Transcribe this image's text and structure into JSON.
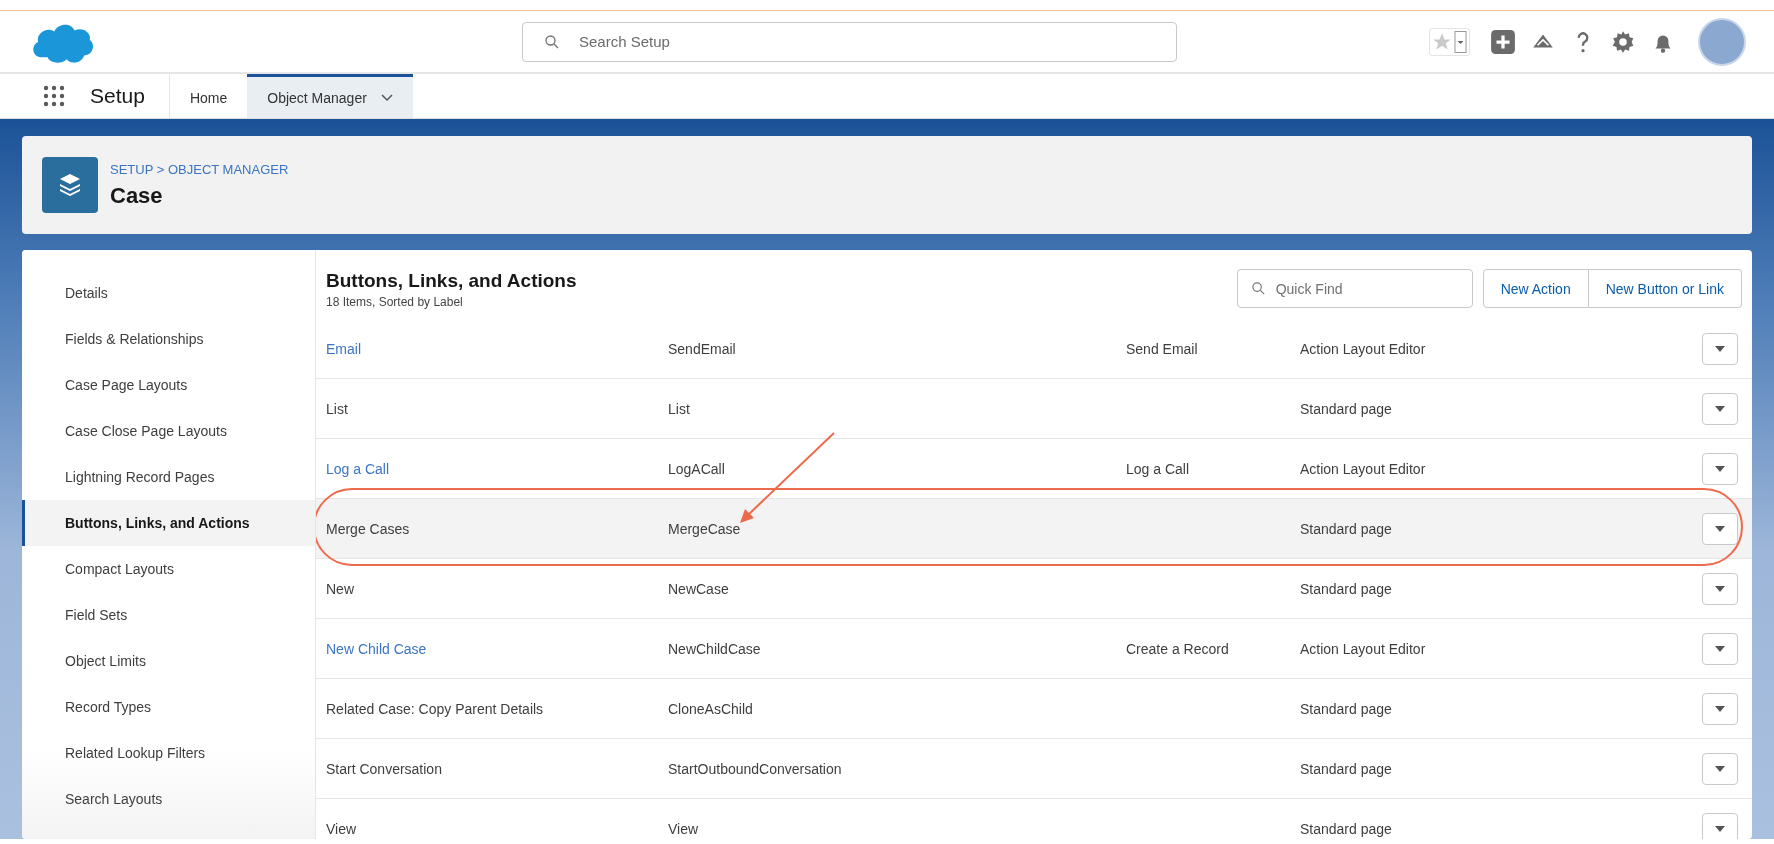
{
  "header": {
    "search": {
      "placeholder": "Search Setup"
    }
  },
  "nav": {
    "app_name": "Setup",
    "tabs": [
      {
        "label": "Home",
        "selected": false,
        "dropdown": false
      },
      {
        "label": "Object Manager",
        "selected": true,
        "dropdown": true
      }
    ]
  },
  "page_header": {
    "breadcrumb": "SETUP > OBJECT MANAGER",
    "title": "Case"
  },
  "sidebar": {
    "items": [
      {
        "label": "Details",
        "selected": false
      },
      {
        "label": "Fields & Relationships",
        "selected": false
      },
      {
        "label": "Case Page Layouts",
        "selected": false
      },
      {
        "label": "Case Close Page Layouts",
        "selected": false
      },
      {
        "label": "Lightning Record Pages",
        "selected": false
      },
      {
        "label": "Buttons, Links, and Actions",
        "selected": true
      },
      {
        "label": "Compact Layouts",
        "selected": false
      },
      {
        "label": "Field Sets",
        "selected": false
      },
      {
        "label": "Object Limits",
        "selected": false
      },
      {
        "label": "Record Types",
        "selected": false
      },
      {
        "label": "Related Lookup Filters",
        "selected": false
      },
      {
        "label": "Search Layouts",
        "selected": false
      }
    ]
  },
  "section": {
    "title": "Buttons, Links, and Actions",
    "subtitle": "18 Items, Sorted by Label",
    "quick_find": {
      "placeholder": "Quick Find"
    },
    "buttons": [
      "New Action",
      "New Button or Link"
    ]
  },
  "table": {
    "rows": [
      {
        "label": "Email",
        "api_name": "SendEmail",
        "column_3": "Send Email",
        "column_4": "Action Layout Editor",
        "link": true,
        "highlighted": false,
        "annotated": false
      },
      {
        "label": "List",
        "api_name": "List",
        "column_4": "Standard page",
        "link": false,
        "highlighted": false,
        "annotated": false
      },
      {
        "label": "Log a Call",
        "api_name": "LogACall",
        "column_3": "Log a Call",
        "column_4": "Action Layout Editor",
        "link": true,
        "highlighted": false,
        "annotated": false
      },
      {
        "label": "Merge Cases",
        "api_name": "MergeCase",
        "column_4": "Standard page",
        "link": false,
        "highlighted": true,
        "annotated": true
      },
      {
        "label": "New",
        "api_name": "NewCase",
        "column_4": "Standard page",
        "link": false,
        "highlighted": false,
        "annotated": false
      },
      {
        "label": "New Child Case",
        "api_name": "NewChildCase",
        "column_3": "Create a Record",
        "column_4": "Action Layout Editor",
        "link": true,
        "highlighted": false,
        "annotated": false
      },
      {
        "label": "Related Case: Copy Parent Details",
        "api_name": "CloneAsChild",
        "column_4": "Standard page",
        "link": false,
        "highlighted": false,
        "annotated": false
      },
      {
        "label": "Start Conversation",
        "api_name": "StartOutboundConversation",
        "column_4": "Standard page",
        "link": false,
        "highlighted": false,
        "annotated": false
      },
      {
        "label": "View",
        "api_name": "View",
        "column_4": "Standard page",
        "link": false,
        "highlighted": false,
        "annotated": false
      }
    ]
  }
}
